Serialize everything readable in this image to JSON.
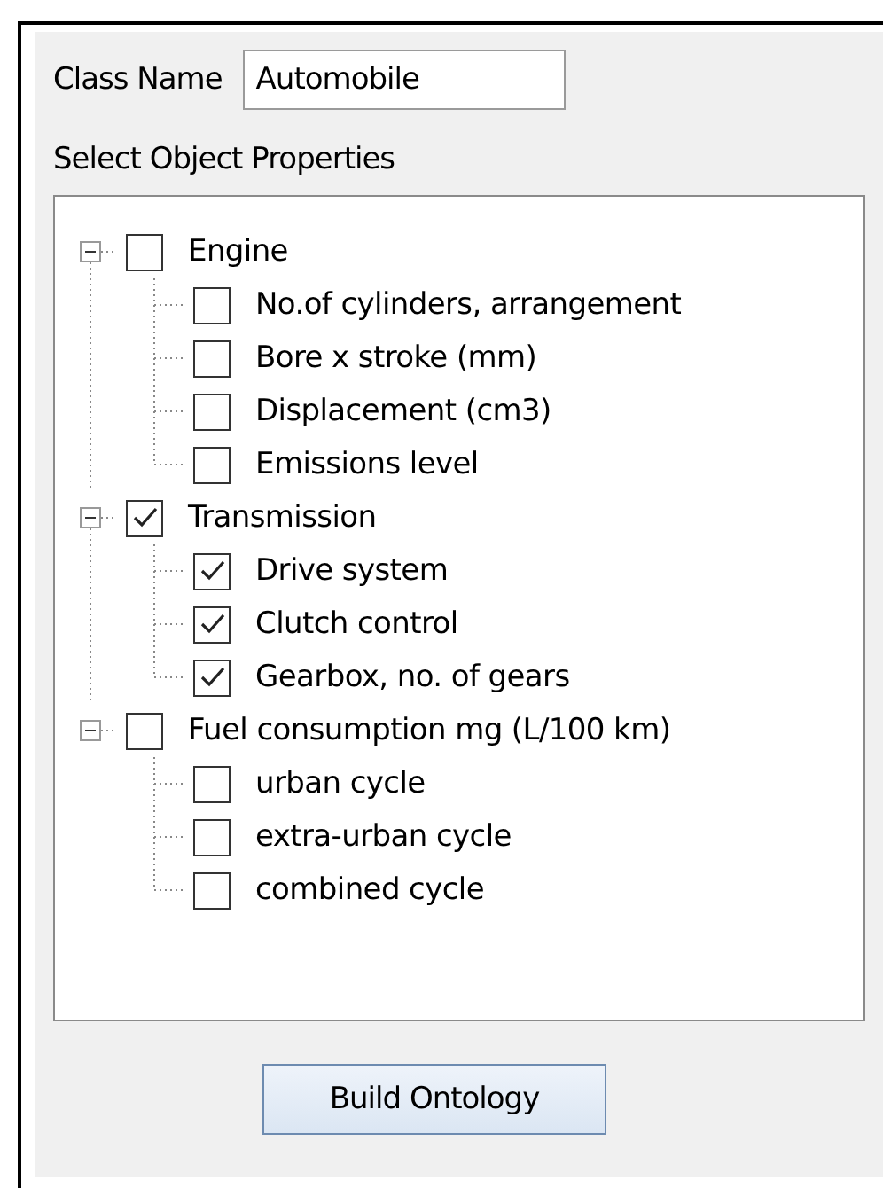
{
  "class_name": {
    "label": "Class Name",
    "value": "Automobile"
  },
  "properties_label": "Select Object Properties",
  "tree": [
    {
      "label": "Engine",
      "checked": false,
      "expanded": true,
      "children": [
        {
          "label": "No.of cylinders, arrangement",
          "checked": false
        },
        {
          "label": "Bore x stroke (mm)",
          "checked": false
        },
        {
          "label": "Displacement (cm3)",
          "checked": false
        },
        {
          "label": "Emissions level",
          "checked": false
        }
      ]
    },
    {
      "label": "Transmission",
      "checked": true,
      "expanded": true,
      "children": [
        {
          "label": "Drive system",
          "checked": true
        },
        {
          "label": "Clutch control",
          "checked": true
        },
        {
          "label": "Gearbox, no. of gears",
          "checked": true
        }
      ]
    },
    {
      "label": "Fuel consumption mg (L/100 km)",
      "checked": false,
      "expanded": true,
      "children": [
        {
          "label": "urban cycle",
          "checked": false
        },
        {
          "label": "extra-urban cycle",
          "checked": false
        },
        {
          "label": "combined cycle",
          "checked": false
        }
      ]
    }
  ],
  "button": "Build Ontology"
}
